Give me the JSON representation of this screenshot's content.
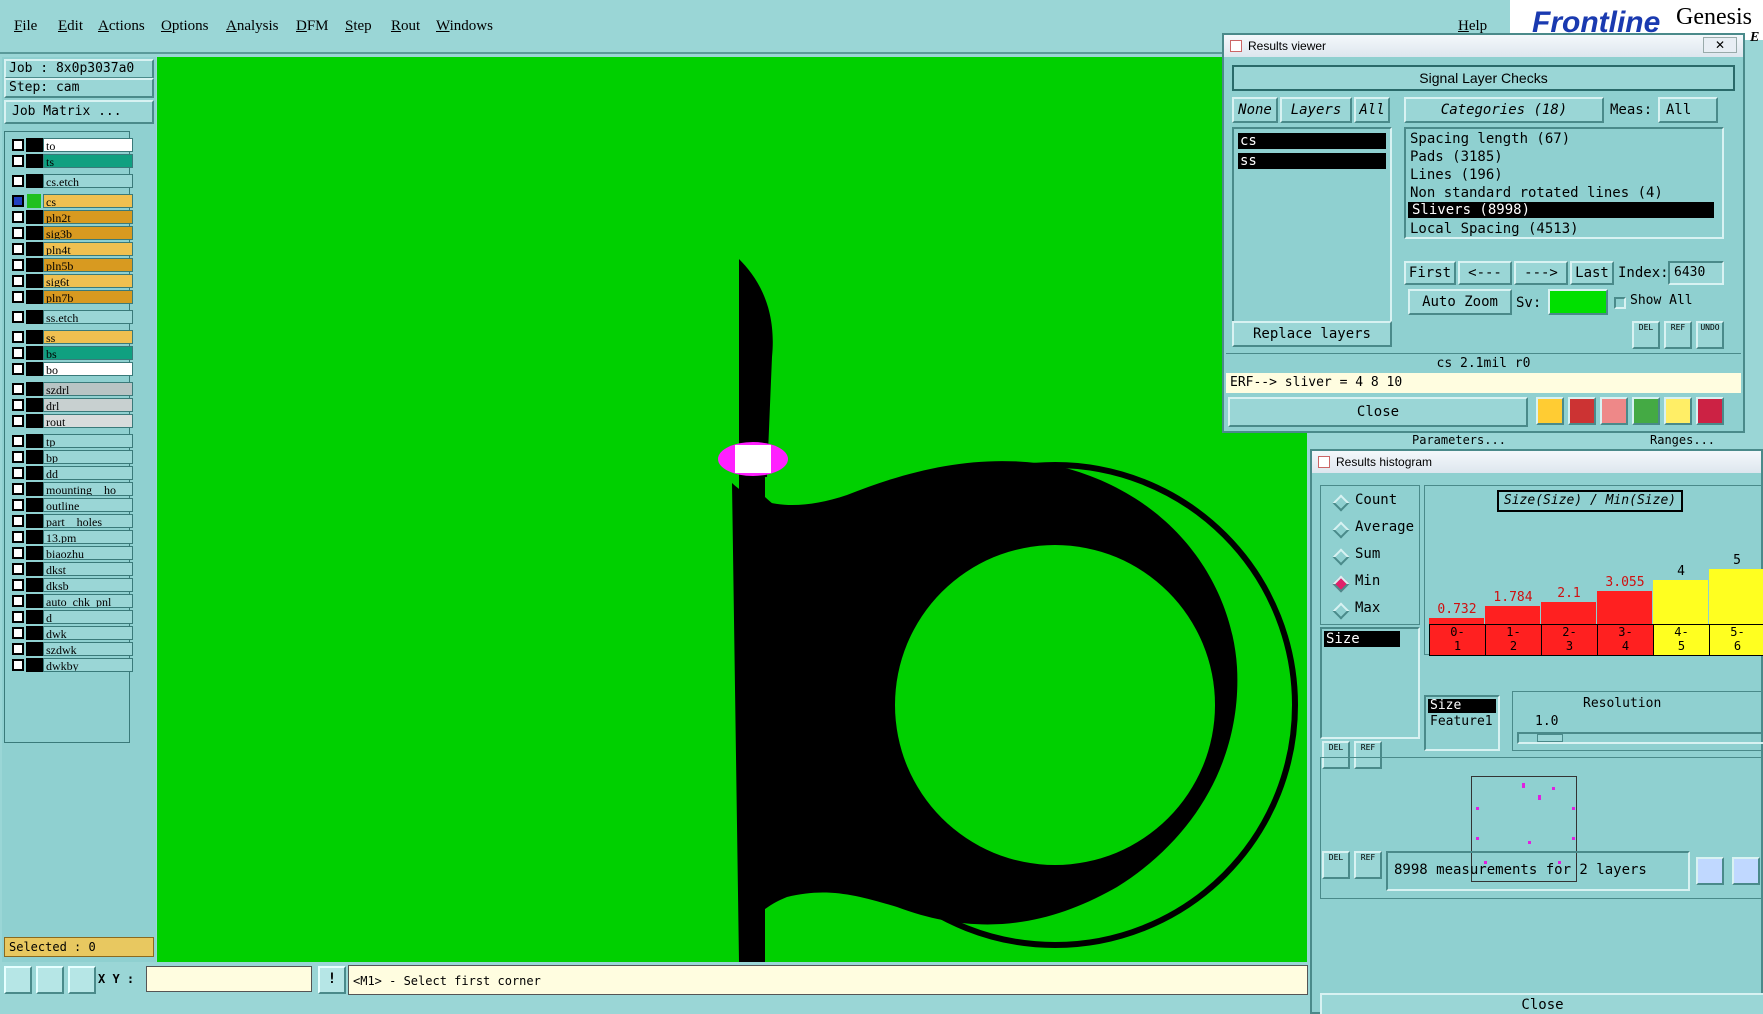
{
  "menu": [
    "File",
    "Edit",
    "Actions",
    "Options",
    "Analysis",
    "DFM",
    "Step",
    "Rout",
    "Windows"
  ],
  "help": "Help",
  "brand": {
    "logo": "Frontline",
    "product": "Genesis",
    "frag": "E"
  },
  "job": {
    "job": "Job : 8x0p3037a0",
    "step": "Step: cam",
    "matrix_btn": "Job Matrix ..."
  },
  "layers": [
    {
      "name": "to",
      "color": "#ffffff",
      "group": 0
    },
    {
      "name": "ts",
      "color": "#10a080",
      "group": 0
    },
    {
      "name": "cs.etch",
      "color": "#9ad6d6",
      "group": 1
    },
    {
      "name": "cs",
      "color": "#f0c050",
      "group": 2,
      "active": true
    },
    {
      "name": "pln2t",
      "color": "#d89a20",
      "group": 2
    },
    {
      "name": "sig3b",
      "color": "#d89a20",
      "group": 2
    },
    {
      "name": "pln4t",
      "color": "#f0c050",
      "group": 2
    },
    {
      "name": "pln5b",
      "color": "#d89a20",
      "group": 2
    },
    {
      "name": "sig6t",
      "color": "#f0c050",
      "group": 2
    },
    {
      "name": "pln7b",
      "color": "#d89a20",
      "group": 2
    },
    {
      "name": "ss.etch",
      "color": "#9ad6d6",
      "group": 3
    },
    {
      "name": "ss",
      "color": "#f0c050",
      "group": 4
    },
    {
      "name": "bs",
      "color": "#10a080",
      "group": 4
    },
    {
      "name": "bo",
      "color": "#ffffff",
      "group": 4
    },
    {
      "name": "szdrl",
      "color": "#b8c4c4",
      "group": 5
    },
    {
      "name": "drl",
      "color": "#c8d0d0",
      "group": 5
    },
    {
      "name": "rout",
      "color": "#d8dcdc",
      "group": 5
    },
    {
      "name": "tp",
      "color": "#9ad6d6",
      "group": 6
    },
    {
      "name": "bp",
      "color": "#9ad6d6",
      "group": 6
    },
    {
      "name": "dd",
      "color": "#9ad6d6",
      "group": 6
    },
    {
      "name": "mounting__ho",
      "color": "#9ad6d6",
      "group": 6
    },
    {
      "name": "outline",
      "color": "#9ad6d6",
      "group": 6
    },
    {
      "name": "part__holes",
      "color": "#9ad6d6",
      "group": 6
    },
    {
      "name": "13.pm",
      "color": "#9ad6d6",
      "group": 6
    },
    {
      "name": "biaozhu",
      "color": "#9ad6d6",
      "group": 6
    },
    {
      "name": "dkst",
      "color": "#9ad6d6",
      "group": 6
    },
    {
      "name": "dksb",
      "color": "#9ad6d6",
      "group": 6
    },
    {
      "name": "auto_chk_pnl",
      "color": "#9ad6d6",
      "group": 6
    },
    {
      "name": "d",
      "color": "#9ad6d6",
      "group": 6
    },
    {
      "name": "dwk",
      "color": "#9ad6d6",
      "group": 6
    },
    {
      "name": "szdwk",
      "color": "#9ad6d6",
      "group": 6
    },
    {
      "name": "dwkby",
      "color": "#9ad6d6",
      "group": 6
    }
  ],
  "selected": "Selected : 0",
  "xy_label": "X Y :",
  "xy_value": "",
  "prompt": "<M1> - Select first corner",
  "colors": {
    "canvas": "#00d000",
    "feature": "#000000",
    "highlight": "#ff20ff"
  },
  "results_viewer": {
    "title": "Results viewer",
    "close_x": "✕",
    "header": "Signal Layer Checks",
    "none": "None",
    "layers_btn": "Layers",
    "all": "All",
    "categories_btn": "Categories (18)",
    "meas_label": "Meas:",
    "meas_value": "All",
    "layer_list": [
      "cs",
      "ss"
    ],
    "categories": [
      "Spacing length (67)",
      "Pads (3185)",
      "Lines (196)",
      "Non standard rotated lines (4)",
      "Slivers (8998)",
      "Local Spacing (4513)"
    ],
    "selected_category": 4,
    "first": "First",
    "prev": "<---",
    "next": "--->",
    "last": "Last",
    "index_label": "Index:",
    "index_value": "6430",
    "auto_zoom": "Auto Zoom",
    "sv_label": "Sv:",
    "show_all": "Show All",
    "replace_layers": "Replace layers",
    "status": "cs 2.1mil   r0",
    "erf": "ERF--> sliver = 4 8 10",
    "close": "Close",
    "del": "DEL",
    "ref": "REF",
    "undo": "UNDO"
  },
  "histogram": {
    "title": "Results histogram",
    "modes": [
      "Count",
      "Average",
      "Sum",
      "Min",
      "Max"
    ],
    "selected_mode": 3,
    "attr_list": [
      "Size"
    ],
    "chart_title": "Size(Size) / Min(Size)",
    "bars": [
      {
        "label": "0.732",
        "bin": "0-\n1",
        "value": 0.732,
        "color": "#ff2020"
      },
      {
        "label": "1.784",
        "bin": "1-\n2",
        "value": 1.784,
        "color": "#ff2020"
      },
      {
        "label": "2.1",
        "bin": "2-\n3",
        "value": 2.1,
        "color": "#ff2020"
      },
      {
        "label": "3.055",
        "bin": "3-\n4",
        "value": 3.055,
        "color": "#ff2020"
      },
      {
        "label": "4",
        "bin": "4-\n5",
        "value": 4,
        "color": "#ffff20"
      },
      {
        "label": "5",
        "bin": "5-\n6",
        "value": 5,
        "color": "#ffff20"
      }
    ],
    "list2": [
      "Size",
      "Feature1"
    ],
    "resolution_label": "Resolution",
    "resolution_value": "1.0",
    "summary": "8998 measurements for 2 layers",
    "close": "Close",
    "del": "DEL",
    "ref": "REF"
  },
  "bg_frag": {
    "params": "Parameters...",
    "ranges": "Ranges..."
  }
}
